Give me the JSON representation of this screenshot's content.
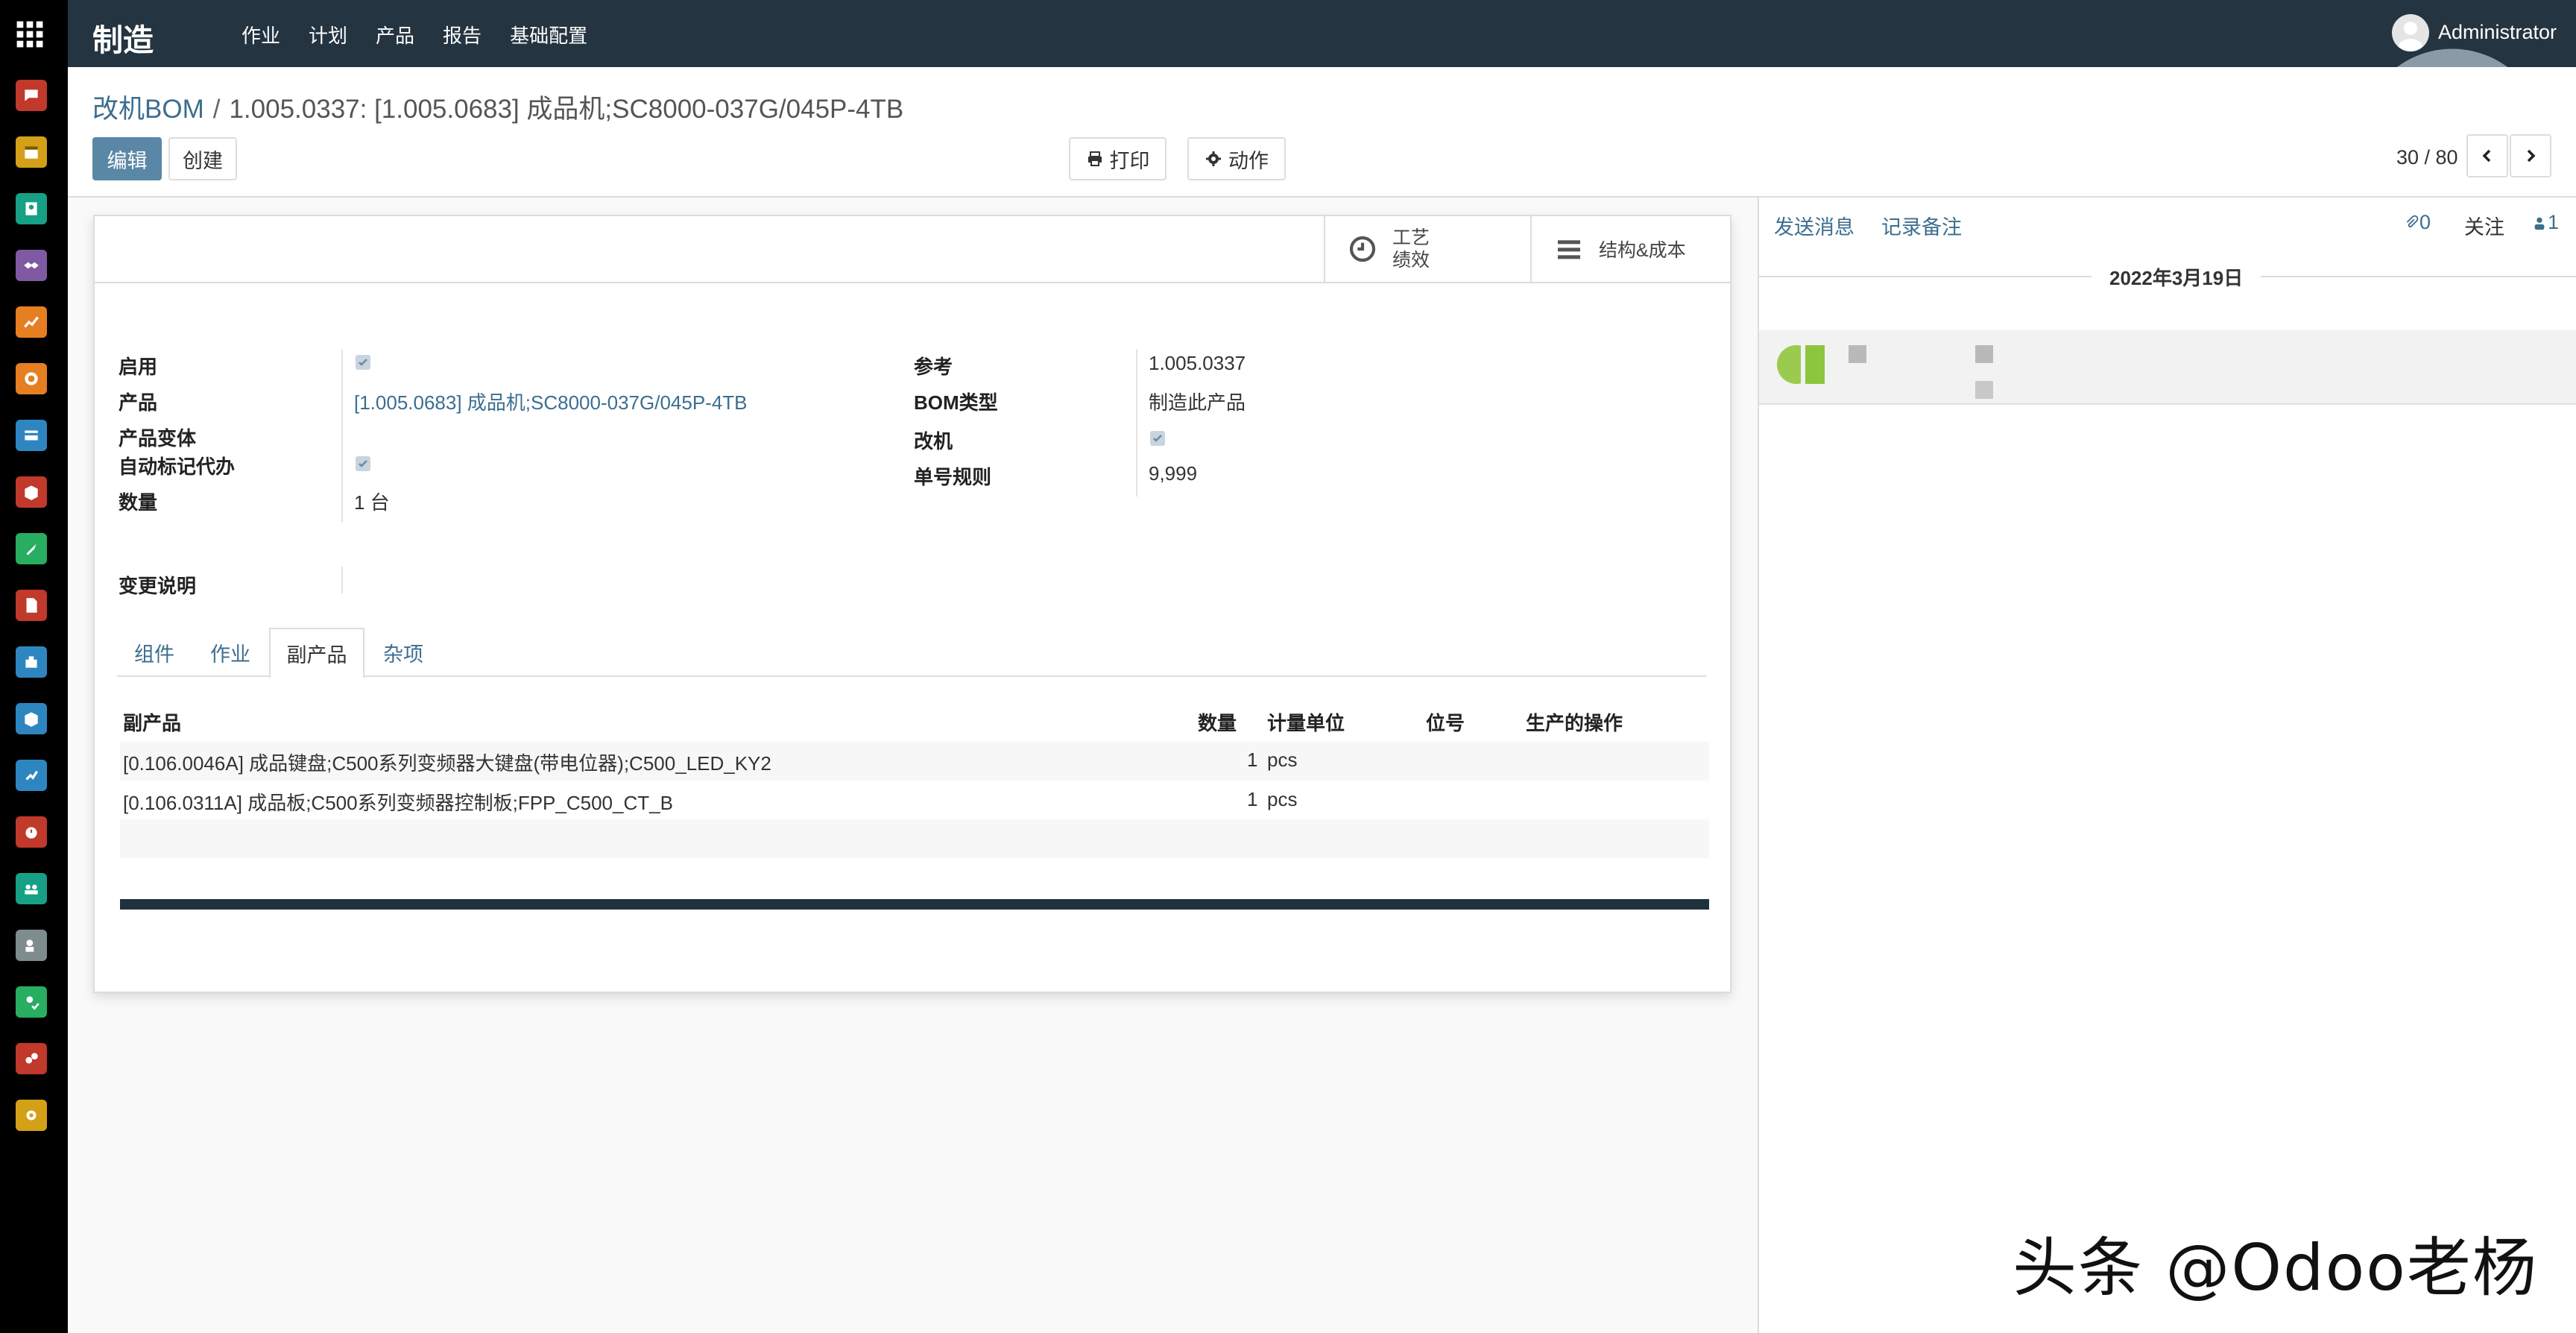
{
  "navbar": {
    "app_title": "制造",
    "menu": [
      "作业",
      "计划",
      "产品",
      "报告",
      "基础配置"
    ],
    "username": "Administrator"
  },
  "breadcrumb": {
    "parent": "改机BOM",
    "separator": "/",
    "current": "1.005.0337: [1.005.0683] 成品机;SC8000-037G/045P-4TB"
  },
  "buttons": {
    "edit": "编辑",
    "create": "创建",
    "print": "打印",
    "action": "动作"
  },
  "pager": {
    "value": "30 / 80"
  },
  "smart_buttons": {
    "routing_line1": "工艺",
    "routing_line2": "绩效",
    "structure_cost": "结构&成本"
  },
  "form": {
    "left": {
      "active_label": "启用",
      "product_label": "产品",
      "product_value": "[1.005.0683] 成品机;SC8000-037G/045P-4TB",
      "variant_label": "产品变体",
      "auto_mark_label": "自动标记代办",
      "qty_label": "数量",
      "qty_value": "1 台"
    },
    "right": {
      "ref_label": "参考",
      "ref_value": "1.005.0337",
      "bom_type_label": "BOM类型",
      "bom_type_value": "制造此产品",
      "modify_label": "改机",
      "number_rule_label": "单号规则",
      "number_rule_value": "9,999"
    },
    "change_note_label": "变更说明"
  },
  "tabs": [
    "组件",
    "作业",
    "副产品",
    "杂项"
  ],
  "active_tab": "副产品",
  "byproducts": {
    "headers": [
      "副产品",
      "数量",
      "计量单位",
      "位号",
      "生产的操作"
    ],
    "rows": [
      {
        "product": "[0.106.0046A] 成品键盘;C500系列变频器大键盘(带电位器);C500_LED_KY2",
        "qty": "1",
        "uom": "pcs"
      },
      {
        "product": "[0.106.0311A] 成品板;C500系列变频器控制板;FPP_C500_CT_B",
        "qty": "1",
        "uom": "pcs"
      }
    ]
  },
  "chatter": {
    "send_message": "发送消息",
    "log_note": "记录备注",
    "attachments": "0",
    "follow": "关注",
    "followers": "1",
    "date": "2022年3月19日"
  },
  "watermark": "头条 @Odoo老杨"
}
